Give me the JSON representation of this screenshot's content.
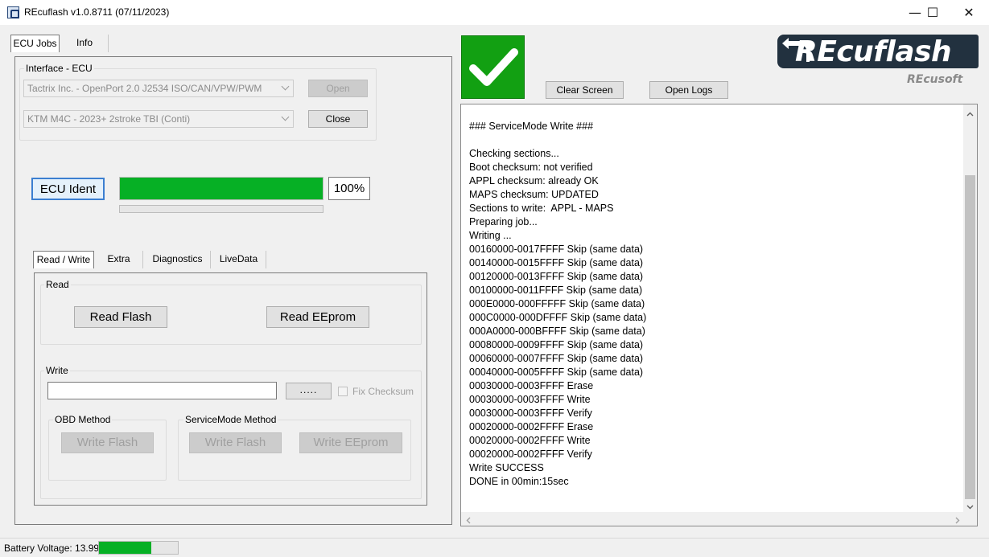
{
  "window": {
    "title": "REcuflash  v1.0.8711 (07/11/2023)",
    "minimize_glyph": "—",
    "maximize_glyph": "☐",
    "close_glyph": "✕"
  },
  "main_tabs": [
    "ECU Jobs",
    "Info"
  ],
  "interface_group": {
    "label": "Interface - ECU",
    "interface_value": "Tactrix Inc. - OpenPort 2.0 J2534 ISO/CAN/VPW/PWM",
    "ecu_value": "KTM M4C - 2023+ 2stroke TBI (Conti)",
    "open_label": "Open",
    "close_label": "Close"
  },
  "ident": {
    "button_label": "ECU Ident",
    "progress_percent": 100,
    "progress_text": "100%",
    "secondary_progress": 0
  },
  "sub_tabs": [
    "Read / Write",
    "Extra",
    "Diagnostics",
    "LiveData"
  ],
  "read_group": {
    "label": "Read",
    "read_flash_label": "Read Flash",
    "read_eeprom_label": "Read EEprom"
  },
  "write_group": {
    "label": "Write",
    "file_value": "",
    "browse_label": ".....",
    "fix_checksum_label": "Fix Checksum",
    "obd_label": "OBD Method",
    "obd_write_flash_label": "Write Flash",
    "service_label": "ServiceMode Method",
    "service_write_flash_label": "Write Flash",
    "service_write_eeprom_label": "Write EEprom"
  },
  "toolbar": {
    "status_icon": "checkmark-icon",
    "status_color": "#12a012",
    "clear_label": "Clear Screen",
    "logs_label": "Open Logs"
  },
  "logo": {
    "name": "REcuflash",
    "company": "REcusoft"
  },
  "log_lines": [
    "### ServiceMode Write ###",
    "",
    "Checking sections...",
    "Boot checksum: not verified",
    "APPL checksum: already OK",
    "MAPS checksum: UPDATED",
    "Sections to write:  APPL - MAPS",
    "Preparing job...",
    "Writing ...",
    "00160000-0017FFFF Skip (same data)",
    "00140000-0015FFFF Skip (same data)",
    "00120000-0013FFFF Skip (same data)",
    "00100000-0011FFFF Skip (same data)",
    "000E0000-000FFFFF Skip (same data)",
    "000C0000-000DFFFF Skip (same data)",
    "000A0000-000BFFFF Skip (same data)",
    "00080000-0009FFFF Skip (same data)",
    "00060000-0007FFFF Skip (same data)",
    "00040000-0005FFFF Skip (same data)",
    "00030000-0003FFFF Erase",
    "00030000-0003FFFF Write",
    "00030000-0003FFFF Verify",
    "00020000-0002FFFF Erase",
    "00020000-0002FFFF Write",
    "00020000-0002FFFF Verify",
    "Write SUCCESS",
    "DONE in 00min:15sec"
  ],
  "status": {
    "battery_label": "Battery Voltage: 13.99",
    "battery_level": 0.66
  }
}
